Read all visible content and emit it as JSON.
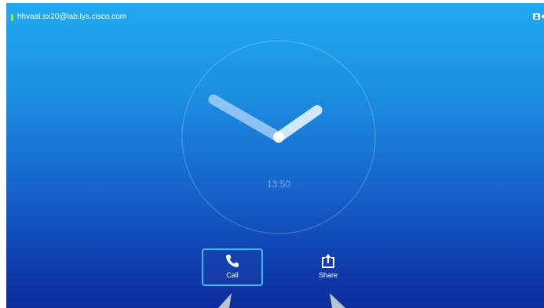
{
  "header": {
    "account": "hhvaal.sx20@lab.lys.cisco.com",
    "status_color": "#9ee33a"
  },
  "clock": {
    "time": "13:50",
    "hour": 13,
    "minute": 50
  },
  "actions": [
    {
      "label": "Call",
      "icon": "phone-icon",
      "selected": true
    },
    {
      "label": "Share",
      "icon": "share-icon",
      "selected": false
    }
  ],
  "colors": {
    "background_top": "#21aaf0",
    "background_bottom": "#0c2c9a",
    "focus_border": "#3fb8f7"
  }
}
